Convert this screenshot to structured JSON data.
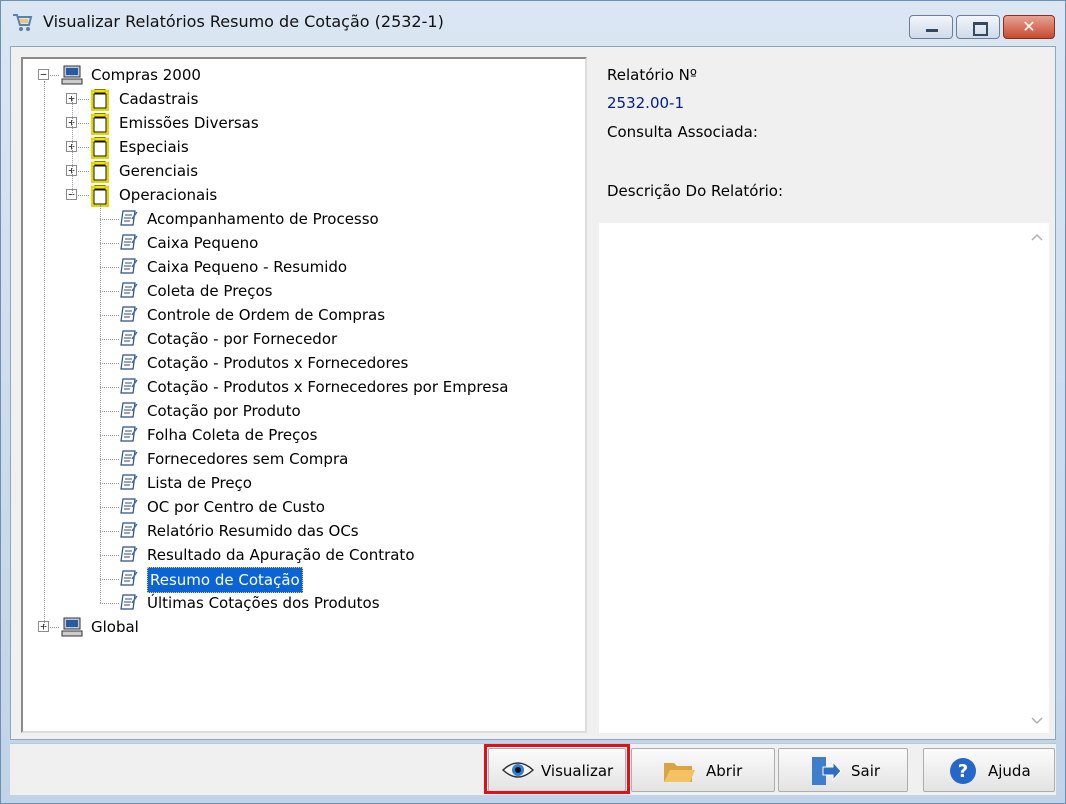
{
  "window": {
    "title": "Visualizar Relatórios Resumo de Cotação (2532-1)",
    "close_symbol": "✕"
  },
  "tree": {
    "root1": "Compras 2000",
    "folders": [
      "Cadastrais",
      "Emissões Diversas",
      "Especiais",
      "Gerenciais",
      "Operacionais"
    ],
    "reports": [
      "Acompanhamento de Processo",
      "Caixa Pequeno",
      "Caixa Pequeno - Resumido",
      "Coleta de Preços",
      "Controle de Ordem de Compras",
      "Cotação - por Fornecedor",
      "Cotação - Produtos x Fornecedores",
      "Cotação - Produtos x Fornecedores por Empresa",
      "Cotação por Produto",
      "Folha Coleta de Preços",
      "Fornecedores sem Compra",
      "Lista de Preço",
      "OC por Centro de Custo",
      "Relatório Resumido das OCs",
      "Resultado da Apuração de Contrato",
      "Resumo de Cotação",
      "Últimas Cotações dos Produtos"
    ],
    "selected_report": "Resumo de Cotação",
    "root2": "Global",
    "expand_plus": "+",
    "expand_minus": "−"
  },
  "info": {
    "report_no_label": "Relatório Nº",
    "report_no_value": "2532.00-1",
    "consulta_label": "Consulta Associada:",
    "descricao_label": "Descrição Do Relatório:"
  },
  "buttons": {
    "visualizar": "Visualizar",
    "abrir": "Abrir",
    "sair": "Sair",
    "ajuda": "Ajuda"
  },
  "colors": {
    "selection": "#0a64d6",
    "highlight": "#e0101a",
    "value_blue": "#00208a"
  }
}
